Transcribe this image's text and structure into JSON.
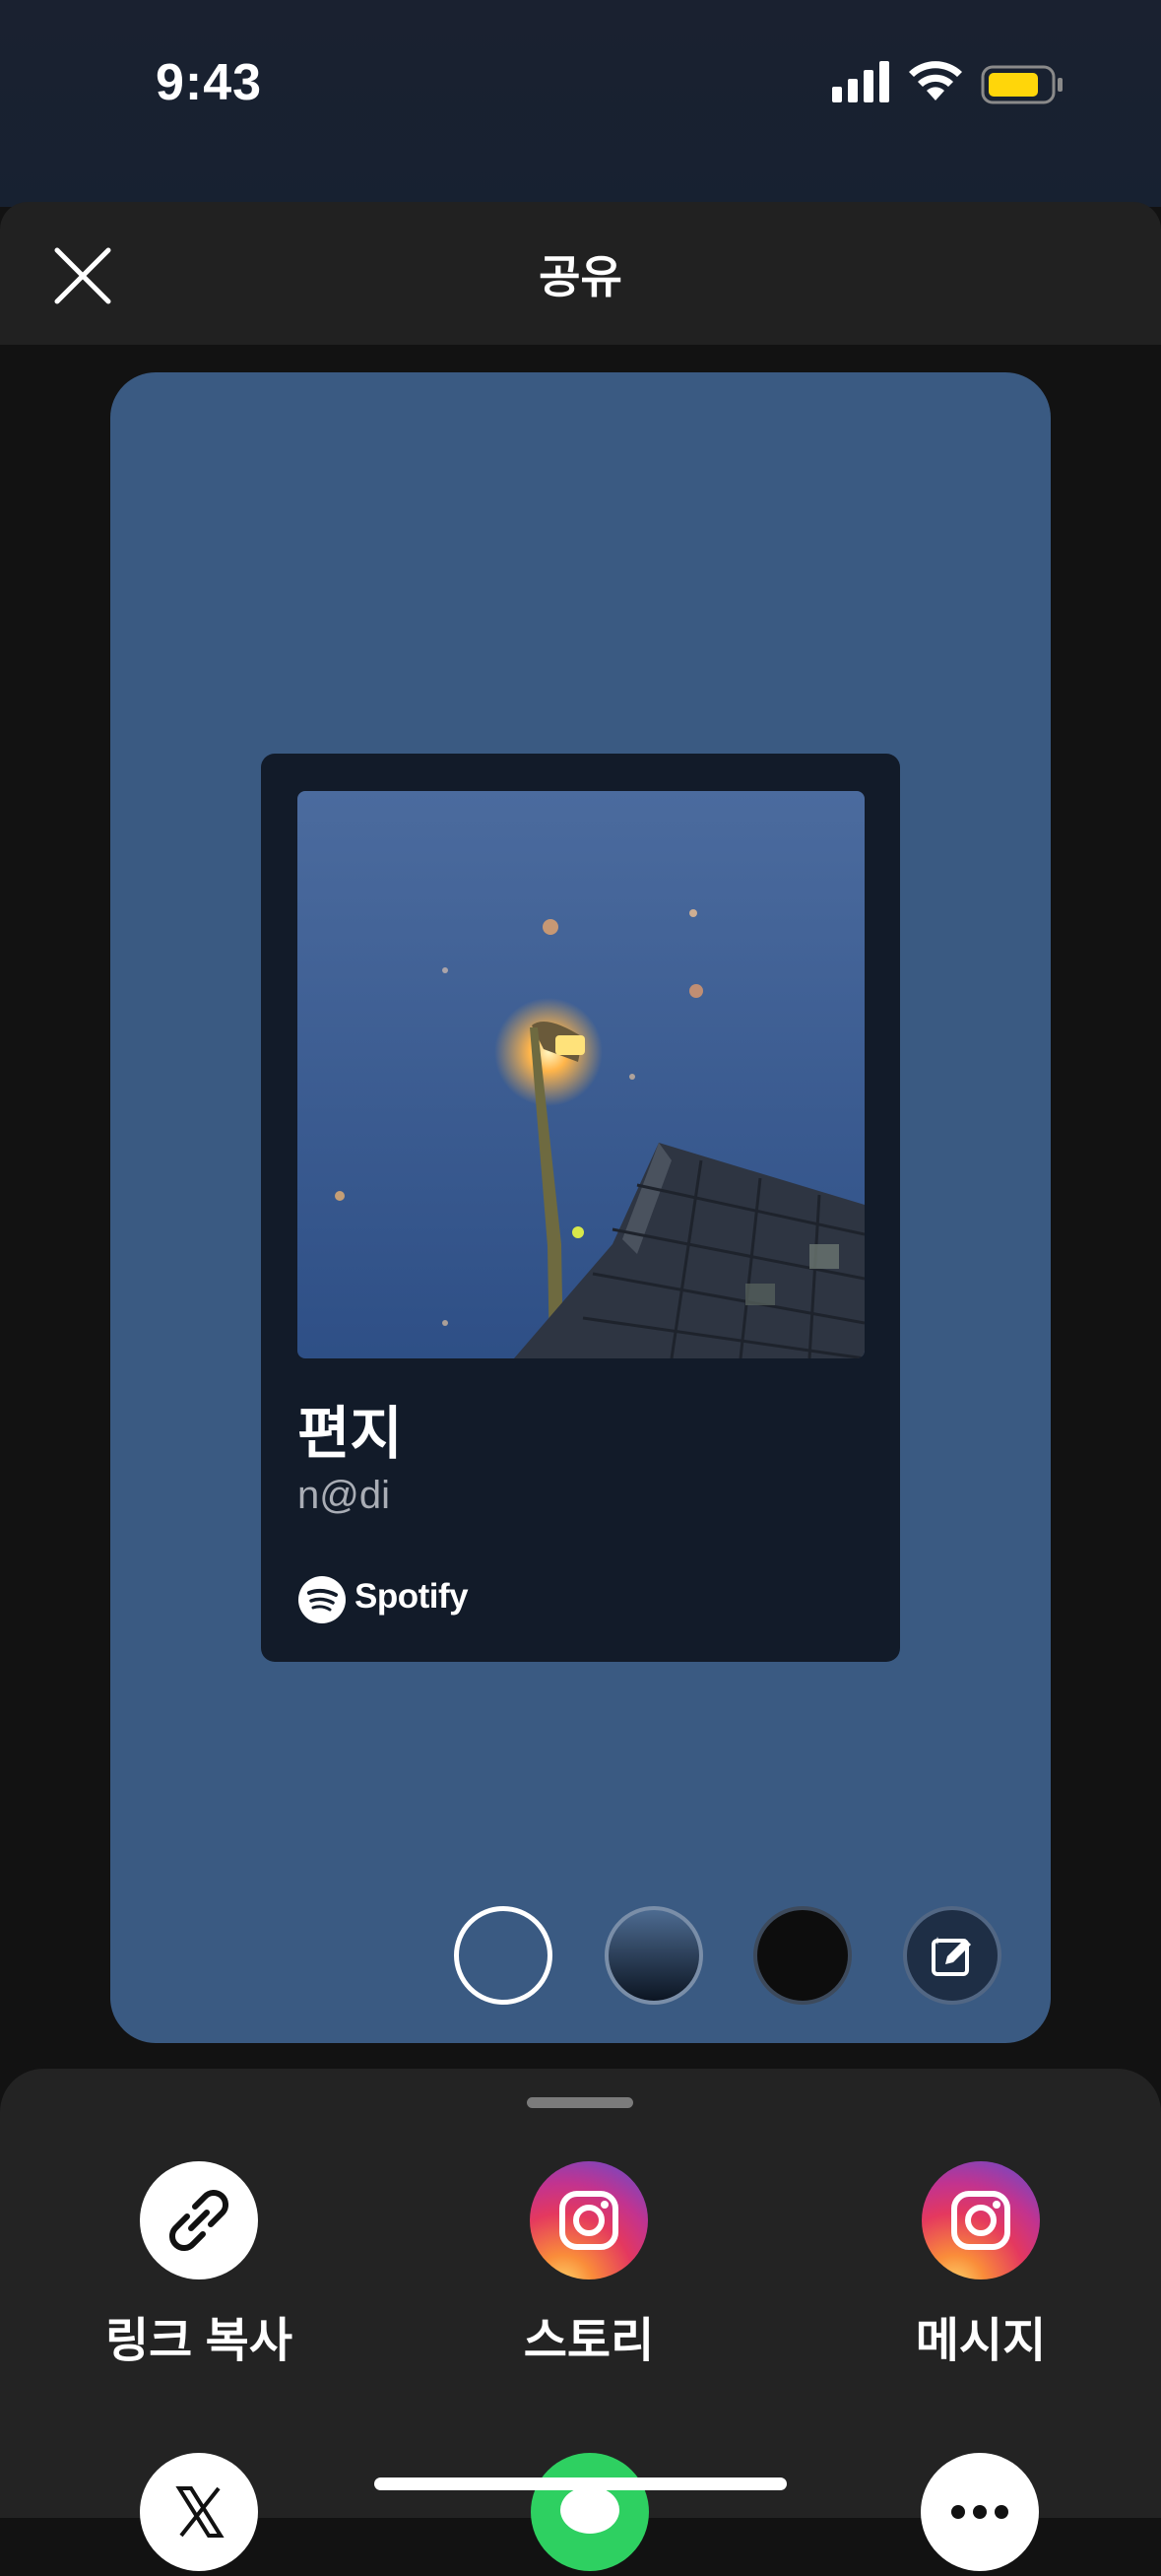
{
  "status_bar": {
    "time": "9:43",
    "icons": [
      "cellular-signal-icon",
      "wifi-icon",
      "battery-icon"
    ],
    "battery_color": "#ffd60a"
  },
  "header": {
    "title": "공유",
    "close_icon": "close-icon"
  },
  "preview": {
    "background": "#3a5a82",
    "card": {
      "song_title": "편지",
      "artist": "n@di",
      "brand": "Spotify"
    },
    "background_options": [
      "white-outline",
      "blue-gradient",
      "black",
      "edit-icon"
    ]
  },
  "share_options": [
    {
      "label": "링크 복사",
      "icon": "link-icon"
    },
    {
      "label": "스토리",
      "icon": "instagram-icon"
    },
    {
      "label": "메시지",
      "icon": "instagram-icon"
    }
  ],
  "more_share_icons": [
    "x-icon",
    "messages-icon",
    "more-icon"
  ]
}
